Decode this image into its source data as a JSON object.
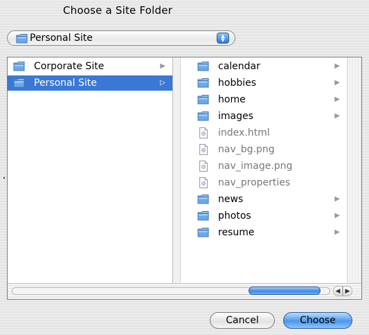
{
  "dialog": {
    "title": "Choose a Site Folder"
  },
  "location_popup": {
    "selected": "Personal Site",
    "icon": "folder-icon"
  },
  "column1": {
    "items": [
      {
        "label": "Corporate Site",
        "type": "folder",
        "selected": false
      },
      {
        "label": "Personal Site",
        "type": "folder",
        "selected": true
      }
    ]
  },
  "column2": {
    "items": [
      {
        "label": "calendar",
        "type": "folder"
      },
      {
        "label": "hobbies",
        "type": "folder"
      },
      {
        "label": "home",
        "type": "folder"
      },
      {
        "label": "images",
        "type": "folder"
      },
      {
        "label": "index.html",
        "type": "file"
      },
      {
        "label": "nav_bg.png",
        "type": "file"
      },
      {
        "label": "nav_image.png",
        "type": "file"
      },
      {
        "label": "nav_properties",
        "type": "file"
      },
      {
        "label": "news",
        "type": "folder"
      },
      {
        "label": "photos",
        "type": "folder"
      },
      {
        "label": "resume",
        "type": "folder"
      }
    ]
  },
  "buttons": {
    "cancel": "Cancel",
    "choose": "Choose"
  },
  "colors": {
    "selection": "#3b78d5",
    "folder": "#6fa8e8",
    "accent_button": "#4d97ea"
  }
}
